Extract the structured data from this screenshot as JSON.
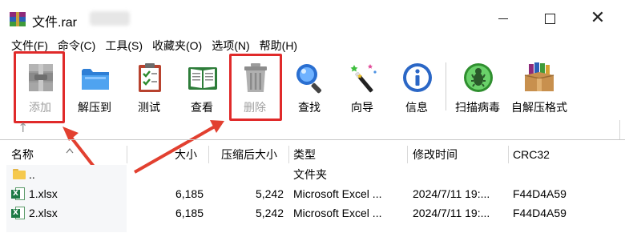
{
  "window": {
    "title": "文件.rar",
    "minimize_icon": "minimize-icon",
    "maximize_icon": "maximize-icon",
    "close_icon": "close-icon",
    "close_glyph": "✕"
  },
  "menu": [
    {
      "label": "文件(F)"
    },
    {
      "label": "命令(C)"
    },
    {
      "label": "工具(S)"
    },
    {
      "label": "收藏夹(O)"
    },
    {
      "label": "选项(N)"
    },
    {
      "label": "帮助(H)"
    }
  ],
  "toolbar": [
    {
      "label": "添加",
      "icon": "archive-add-icon",
      "enabled": false,
      "highlighted": true
    },
    {
      "label": "解压到",
      "icon": "folder-extract-icon",
      "enabled": true
    },
    {
      "label": "测试",
      "icon": "clipboard-test-icon",
      "enabled": true
    },
    {
      "label": "查看",
      "icon": "book-view-icon",
      "enabled": true
    },
    {
      "label": "删除",
      "icon": "trash-icon",
      "enabled": false,
      "highlighted": true
    },
    {
      "label": "查找",
      "icon": "magnifier-icon",
      "enabled": true
    },
    {
      "label": "向导",
      "icon": "magic-wand-icon",
      "enabled": true
    },
    {
      "label": "信息",
      "icon": "info-icon",
      "enabled": true
    },
    {
      "label": "扫描病毒",
      "icon": "virus-scan-icon",
      "enabled": true
    },
    {
      "label": "自解压格式",
      "icon": "sfx-box-icon",
      "enabled": true
    }
  ],
  "path": {
    "up_glyph": "↑"
  },
  "columns": {
    "name": "名称",
    "size": "大小",
    "packed": "压缩后大小",
    "type": "类型",
    "modified": "修改时间",
    "crc": "CRC32"
  },
  "rows": [
    {
      "name": "..",
      "size": "",
      "packed": "",
      "type": "文件夹",
      "modified": "",
      "crc": "",
      "icon": "folder-icon"
    },
    {
      "name": "1.xlsx",
      "size": "6,185",
      "packed": "5,242",
      "type": "Microsoft Excel ...",
      "modified": "2024/7/11 19:...",
      "crc": "F44D4A59",
      "icon": "excel-file-icon"
    },
    {
      "name": "2.xlsx",
      "size": "6,185",
      "packed": "5,242",
      "type": "Microsoft Excel ...",
      "modified": "2024/7/11 19:...",
      "crc": "F44D4A59",
      "icon": "excel-file-icon"
    }
  ],
  "colors": {
    "highlight": "#e02a2a",
    "disabled_text": "#a0a0a0"
  }
}
